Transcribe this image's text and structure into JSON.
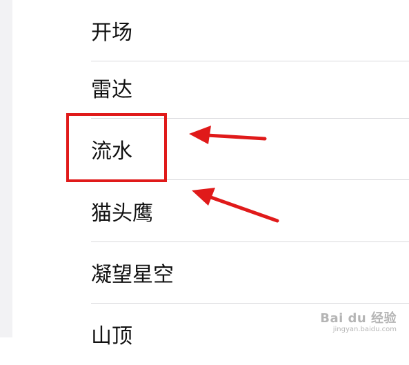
{
  "list": {
    "items": [
      {
        "label": "开场"
      },
      {
        "label": "雷达"
      },
      {
        "label": "流水"
      },
      {
        "label": "猫头鹰"
      },
      {
        "label": "凝望星空"
      },
      {
        "label": "山顶"
      }
    ]
  },
  "annotation": {
    "highlight_color": "#e01a1a",
    "highlighted_item": "流水"
  },
  "watermark": {
    "brand": "Bai du 经验",
    "url": "jingyan.baidu.com"
  }
}
